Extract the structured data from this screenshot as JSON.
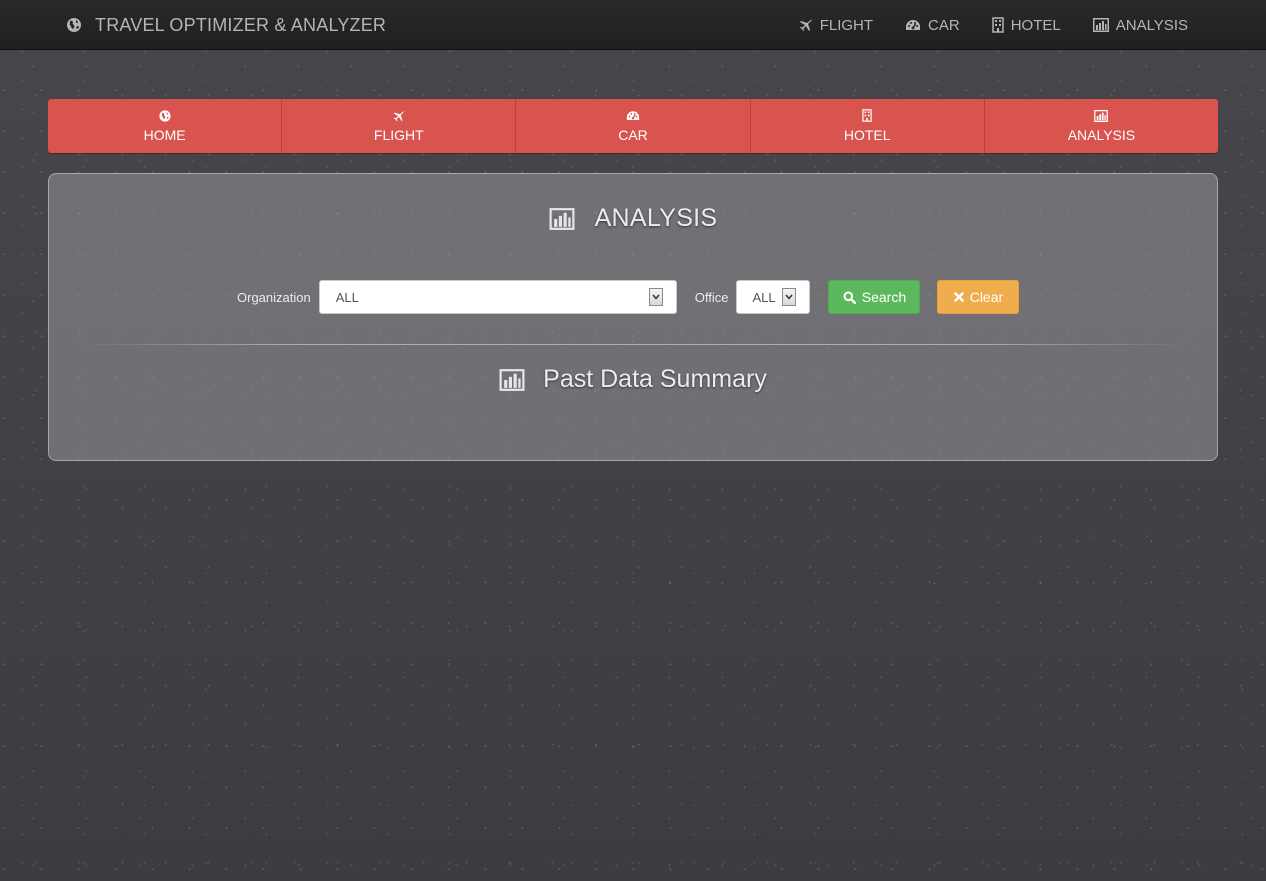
{
  "navbar": {
    "brand": {
      "title": "TRAVEL OPTIMIZER & ANALYZER",
      "icon": "globe-icon"
    },
    "links": [
      {
        "label": "FLIGHT",
        "icon": "plane-icon"
      },
      {
        "label": "CAR",
        "icon": "dashboard-icon"
      },
      {
        "label": "HOTEL",
        "icon": "building-icon"
      },
      {
        "label": "ANALYSIS",
        "icon": "bar-chart-icon"
      }
    ]
  },
  "tabs": [
    {
      "label": "HOME",
      "icon": "globe-icon"
    },
    {
      "label": "FLIGHT",
      "icon": "plane-icon"
    },
    {
      "label": "CAR",
      "icon": "dashboard-icon"
    },
    {
      "label": "HOTEL",
      "icon": "building-icon"
    },
    {
      "label": "ANALYSIS",
      "icon": "bar-chart-icon"
    }
  ],
  "panel": {
    "title": "ANALYSIS",
    "title_icon": "bar-chart-icon",
    "filters": {
      "organization_label": "Organization",
      "organization_value": "ALL",
      "office_label": "Office",
      "office_value": "ALL"
    },
    "search_label": "Search",
    "clear_label": "Clear",
    "summary_title": "Past Data Summary",
    "summary_icon": "bar-chart-icon"
  },
  "colors": {
    "background": "#3f3f44",
    "navbar": "#222222",
    "tab_red": "#d9534f",
    "search_green": "#5cb85c",
    "clear_orange": "#f0ad4e"
  }
}
